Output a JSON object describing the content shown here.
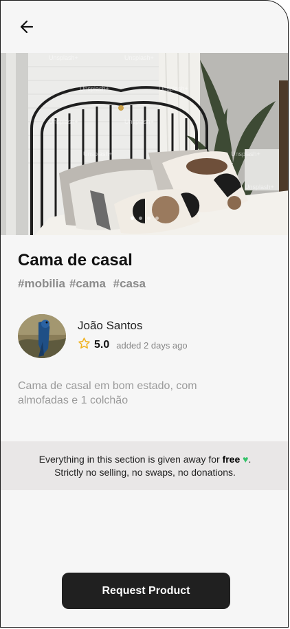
{
  "product": {
    "title": "Cama de casal",
    "tags": [
      "#mobilia",
      "#cama",
      " #casa"
    ],
    "description": "Cama de casal em bom estado, com almofadas e 1 colchão",
    "image_watermark": "Unsplash+"
  },
  "seller": {
    "name": "João Santos",
    "rating": "5.0",
    "added": "added 2 days ago"
  },
  "notice": {
    "line1_prefix": "Everything in this section is given away for ",
    "line1_bold": "free",
    "line1_suffix": ".",
    "line2": "Strictly no selling, no swaps, no donations."
  },
  "carousel": {
    "count": 4,
    "active": 0
  },
  "actions": {
    "request_label": "Request Product"
  },
  "icons": {
    "back": "arrow-left-icon",
    "star": "star-outline-icon",
    "heart": "green-heart-icon"
  },
  "colors": {
    "star": "#f0b323",
    "cta_bg": "#202020",
    "notice_bg": "#e9e7e7",
    "heart": "#35c26a"
  }
}
